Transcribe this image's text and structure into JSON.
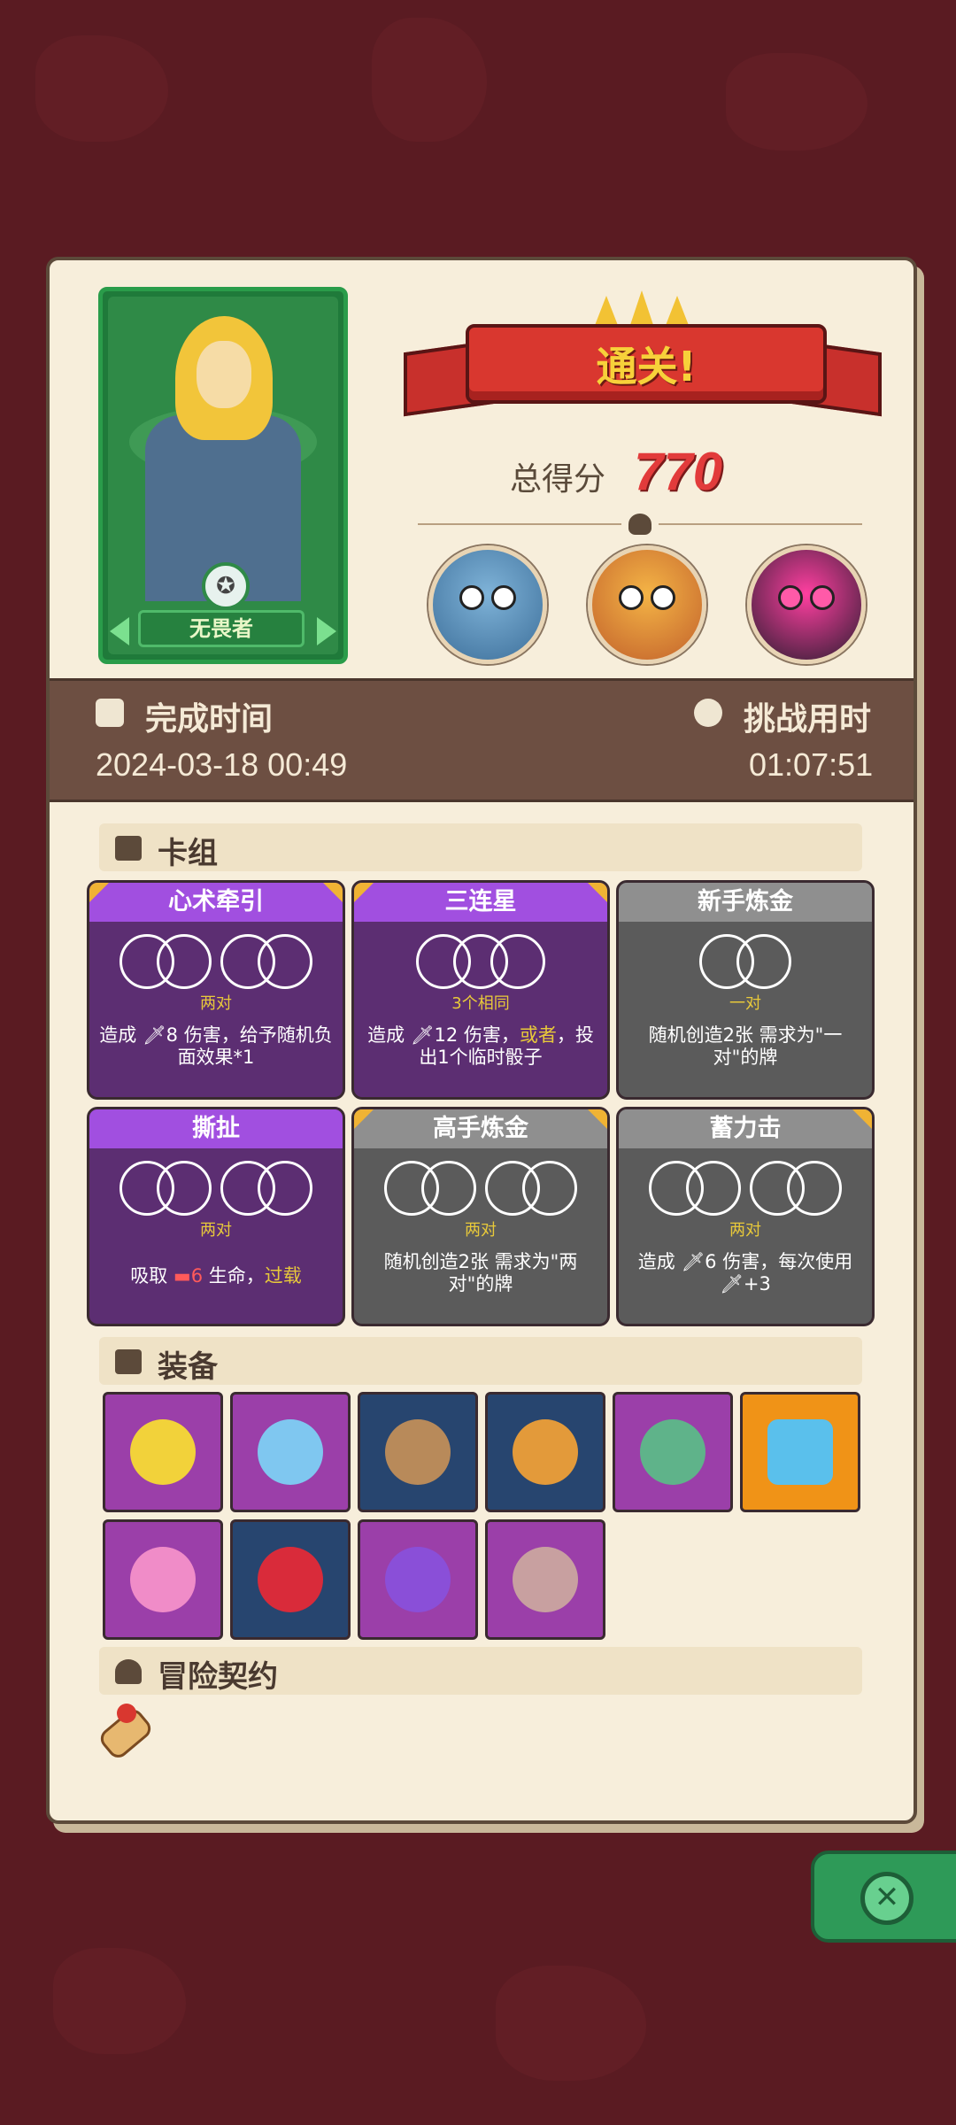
{
  "result": {
    "banner": "通关!",
    "score_label": "总得分",
    "score_value": "770"
  },
  "hero": {
    "name": "无畏者"
  },
  "time": {
    "complete_label": "完成时间",
    "complete_value": "2024-03-18 00:49",
    "challenge_label": "挑战用时",
    "challenge_value": "01:07:51"
  },
  "deck": {
    "title": "卡组",
    "cards": [
      {
        "name": "心术牵引",
        "tag": "两对",
        "desc_a": "造成 ",
        "desc_b": "8 伤害，给予随机负面效果*1",
        "rarity": "purple"
      },
      {
        "name": "三连星",
        "tag": "3个相同",
        "desc_a": "造成 ",
        "desc_b": "12 伤害，",
        "desc_hl": "或者",
        "desc_c": "，投出1个临时骰子",
        "rarity": "purple"
      },
      {
        "name": "新手炼金",
        "tag": "一对",
        "desc": "随机创造2张 需求为\"一对\"的牌",
        "rarity": "gray"
      },
      {
        "name": "撕扯",
        "tag": "两对",
        "desc_a": "吸取 ",
        "desc_num": "6",
        "desc_b": " 生命，",
        "desc_hl": "过载",
        "rarity": "purple"
      },
      {
        "name": "高手炼金",
        "tag": "两对",
        "desc": "随机创造2张 需求为\"两对\"的牌",
        "rarity": "gray"
      },
      {
        "name": "蓄力击",
        "tag": "两对",
        "desc_a": "造成 ",
        "desc_b": "6 伤害，每次使用",
        "desc_c": "+3",
        "rarity": "gray"
      }
    ]
  },
  "equipment": {
    "title": "装备",
    "items": [
      {
        "icon": "moon-star-icon",
        "bg": "purple"
      },
      {
        "icon": "gem-ring-icon",
        "bg": "purple"
      },
      {
        "icon": "horn-icon",
        "bg": "blue"
      },
      {
        "icon": "fruit-pot-icon",
        "bg": "blue"
      },
      {
        "icon": "demon-mask-icon",
        "bg": "purple"
      },
      {
        "icon": "shield-crystal-icon",
        "bg": "orange"
      },
      {
        "icon": "heart-charm-icon",
        "bg": "purple"
      },
      {
        "icon": "ruby-icon",
        "bg": "blue"
      },
      {
        "icon": "potion-icon",
        "bg": "purple"
      },
      {
        "icon": "round-shield-icon",
        "bg": "purple"
      }
    ]
  },
  "contract": {
    "title": "冒险契约"
  },
  "colors": {
    "accent_red": "#e23b3b",
    "gold": "#e8c93a",
    "panel": "#f7eedb"
  }
}
